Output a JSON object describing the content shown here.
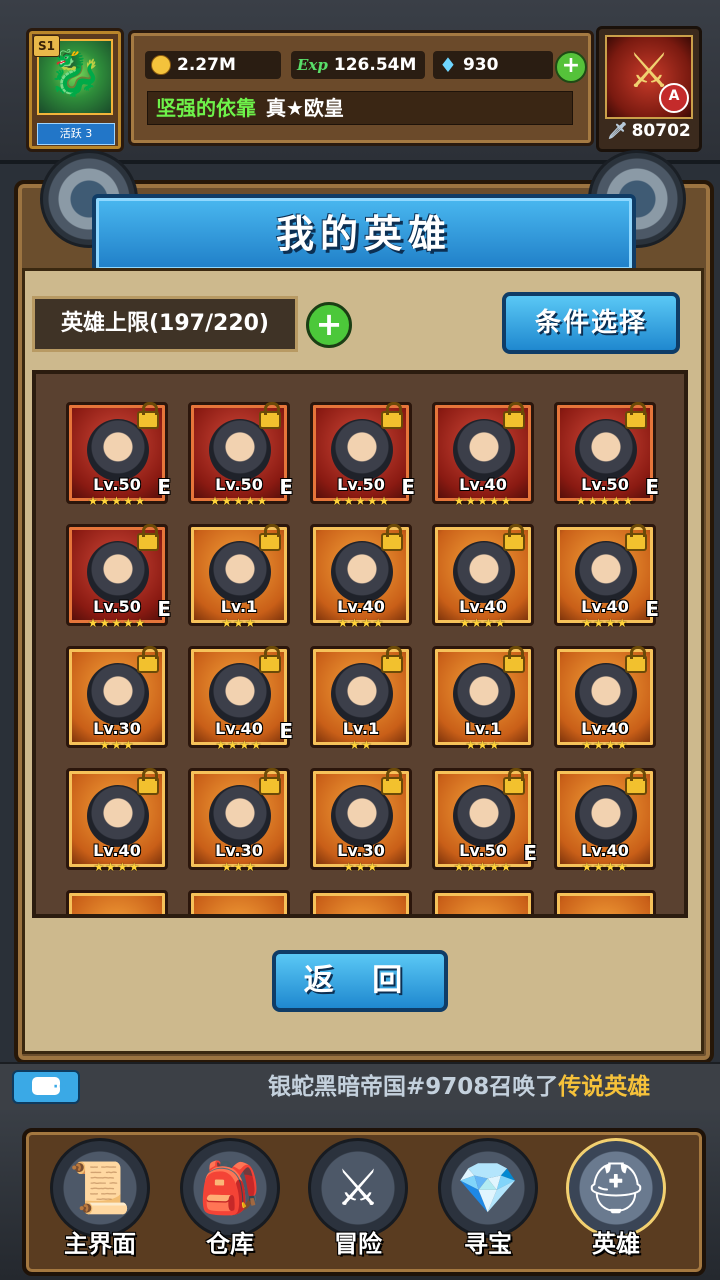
{
  "player": {
    "season": "S1",
    "active": "活跃 3",
    "gold": "2.27M",
    "exp_icon": "Exp",
    "exp": "126.54M",
    "diamonds": "930",
    "guild": "坚强的依靠",
    "title": "真★欧皇",
    "rank_letter": "A",
    "power": "80702"
  },
  "window": {
    "title": "我的英雄",
    "hero_limit": "英雄上限(197/220)",
    "filter_button": "条件选择",
    "back_button": "返 回"
  },
  "heroes": [
    {
      "level": "Lv.50",
      "equip": "E",
      "stars": 5,
      "max_stars": 5,
      "frame": "red",
      "icon": "knight-icon"
    },
    {
      "level": "Lv.50",
      "equip": "E",
      "stars": 5,
      "max_stars": 5,
      "frame": "red",
      "icon": "valkyrie-icon"
    },
    {
      "level": "Lv.50",
      "equip": "E",
      "stars": 5,
      "max_stars": 5,
      "frame": "red",
      "icon": "ninja-icon"
    },
    {
      "level": "Lv.40",
      "equip": "",
      "stars": 5,
      "max_stars": 5,
      "frame": "red",
      "icon": "soldier-icon"
    },
    {
      "level": "Lv.50",
      "equip": "E",
      "stars": 5,
      "max_stars": 5,
      "frame": "red",
      "icon": "demon-icon"
    },
    {
      "level": "Lv.50",
      "equip": "E",
      "stars": 5,
      "max_stars": 5,
      "frame": "red",
      "icon": "demon-icon"
    },
    {
      "level": "Lv.1",
      "equip": "",
      "stars": 3,
      "max_stars": 3,
      "frame": "orange",
      "icon": "monk-icon"
    },
    {
      "level": "Lv.40",
      "equip": "",
      "stars": 4,
      "max_stars": 4,
      "frame": "orange",
      "icon": "monk-icon"
    },
    {
      "level": "Lv.40",
      "equip": "",
      "stars": 4,
      "max_stars": 4,
      "frame": "orange",
      "icon": "monk-icon"
    },
    {
      "level": "Lv.40",
      "equip": "E",
      "stars": 4,
      "max_stars": 4,
      "frame": "orange",
      "icon": "jester-icon"
    },
    {
      "level": "Lv.30",
      "equip": "",
      "stars": 3,
      "max_stars": 3,
      "frame": "orange",
      "icon": "magician-icon"
    },
    {
      "level": "Lv.40",
      "equip": "E",
      "stars": 4,
      "max_stars": 4,
      "frame": "orange",
      "icon": "magician-icon"
    },
    {
      "level": "Lv.1",
      "equip": "",
      "stars": 2,
      "max_stars": 2,
      "frame": "orange",
      "icon": "monkey-icon"
    },
    {
      "level": "Lv.1",
      "equip": "",
      "stars": 3,
      "max_stars": 3,
      "frame": "orange",
      "icon": "golem-icon"
    },
    {
      "level": "Lv.40",
      "equip": "",
      "stars": 4,
      "max_stars": 4,
      "frame": "orange",
      "icon": "golem-icon"
    },
    {
      "level": "Lv.40",
      "equip": "",
      "stars": 4,
      "max_stars": 4,
      "frame": "orange",
      "icon": "swordswoman-icon"
    },
    {
      "level": "Lv.30",
      "equip": "",
      "stars": 3,
      "max_stars": 3,
      "frame": "orange",
      "icon": "swordswoman-icon"
    },
    {
      "level": "Lv.30",
      "equip": "",
      "stars": 3,
      "max_stars": 3,
      "frame": "orange",
      "icon": "pilot-icon"
    },
    {
      "level": "Lv.50",
      "equip": "E",
      "stars": 5,
      "max_stars": 5,
      "frame": "orange",
      "icon": "pilot-icon"
    },
    {
      "level": "Lv.40",
      "equip": "",
      "stars": 4,
      "max_stars": 4,
      "frame": "orange",
      "icon": "rogue-icon"
    }
  ],
  "chat": {
    "text_prefix": "银蛇黑暗帝国#9708召唤了",
    "text_highlight": "传说英雄"
  },
  "nav": [
    {
      "label": "主界面",
      "icon": "scroll-map-icon",
      "glyph": "📜"
    },
    {
      "label": "仓库",
      "icon": "backpack-icon",
      "glyph": "🎒"
    },
    {
      "label": "冒险",
      "icon": "sword-emblem-icon",
      "glyph": "⚔"
    },
    {
      "label": "寻宝",
      "icon": "crystal-icon",
      "glyph": "💎"
    },
    {
      "label": "英雄",
      "icon": "helmet-icon",
      "glyph": "⛑"
    }
  ]
}
